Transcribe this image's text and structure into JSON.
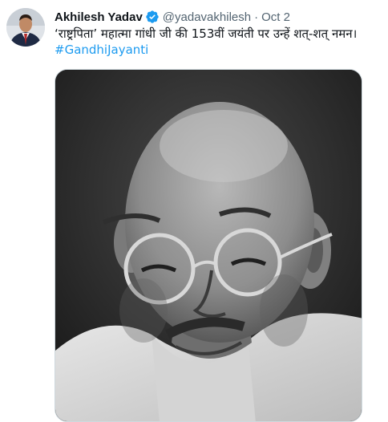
{
  "tweet": {
    "author_name": "Akhilesh Yadav",
    "handle": "@yadavakhilesh",
    "separator": "·",
    "date": "Oct 2",
    "text": "‘राष्ट्रपिता’ महात्मा गांधी जी की 153वीं जयंती पर उन्हें शत्-शत् नमन।",
    "hashtag": "#GandhiJayanti"
  },
  "icons": {
    "verified": "verified-badge-icon"
  },
  "colors": {
    "link": "#1d9bf0",
    "verified": "#1d9bf0",
    "text_primary": "#0f1419",
    "text_secondary": "#536471"
  }
}
